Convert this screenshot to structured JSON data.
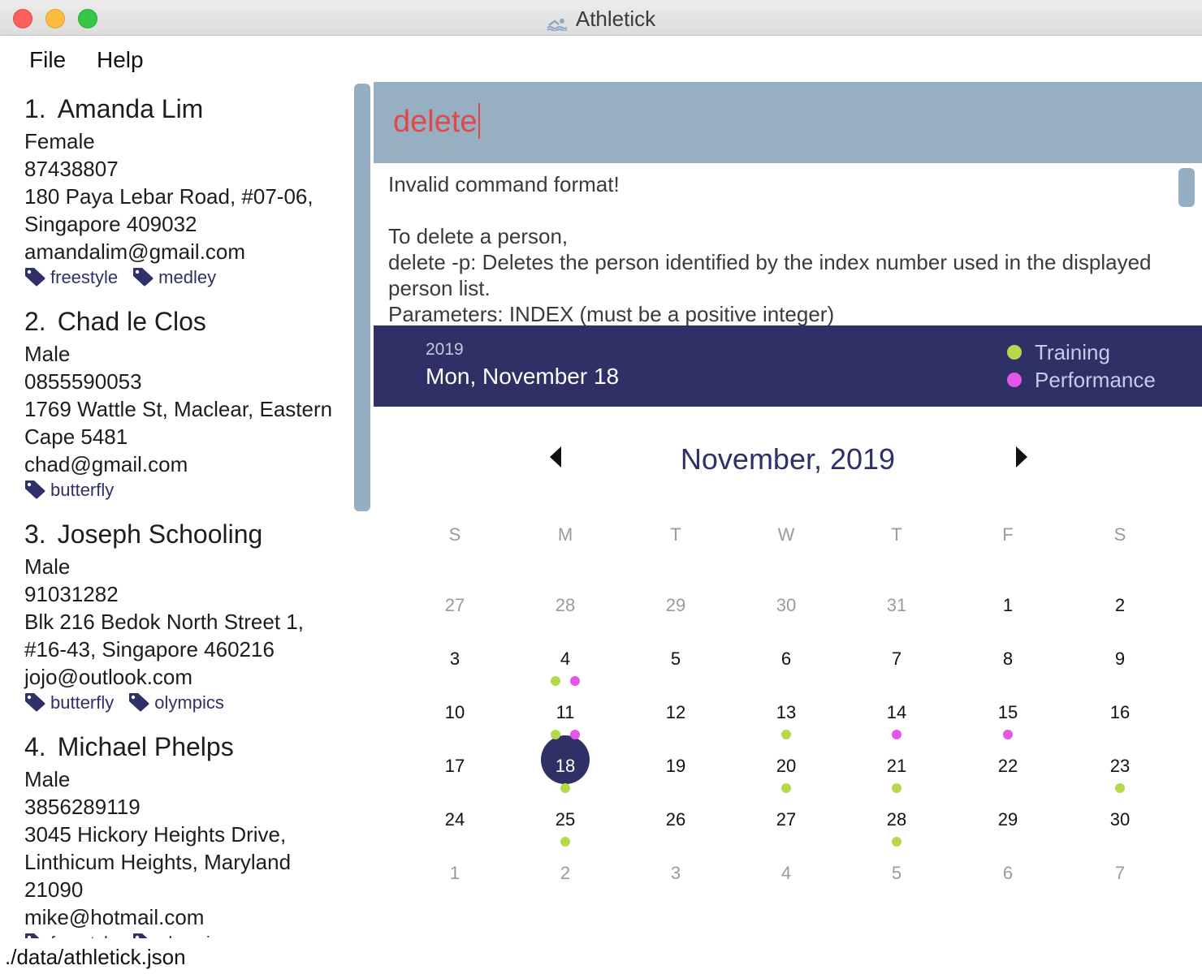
{
  "window": {
    "title": "Athletick"
  },
  "menu": {
    "file": "File",
    "help": "Help"
  },
  "persons": [
    {
      "index": "1.",
      "name": "Amanda Lim",
      "gender": "Female",
      "phone": "87438807",
      "address_lines": [
        "180 Paya Lebar Road, #07-06,",
        "Singapore 409032"
      ],
      "email": "amandalim@gmail.com",
      "tags": [
        "freestyle",
        "medley"
      ]
    },
    {
      "index": "2.",
      "name": "Chad le Clos",
      "gender": "Male",
      "phone": "0855590053",
      "address_lines": [
        "1769 Wattle St, Maclear, Eastern",
        "Cape 5481"
      ],
      "email": "chad@gmail.com",
      "tags": [
        "butterfly"
      ]
    },
    {
      "index": "3.",
      "name": "Joseph Schooling",
      "gender": "Male",
      "phone": "91031282",
      "address_lines": [
        "Blk 216 Bedok North Street 1,",
        "#16-43, Singapore 460216"
      ],
      "email": "jojo@outlook.com",
      "tags": [
        "butterfly",
        "olympics"
      ]
    },
    {
      "index": "4.",
      "name": "Michael Phelps",
      "gender": "Male",
      "phone": "3856289119",
      "address_lines": [
        "3045 Hickory Heights Drive,",
        "Linthicum Heights, Maryland",
        "21090"
      ],
      "email": "mike@hotmail.com",
      "tags": [
        "freestyle",
        "olympics"
      ]
    }
  ],
  "command": {
    "value": "delete"
  },
  "result": {
    "text": "Invalid command format!\n\nTo delete a person,\ndelete -p: Deletes the person identified by the index number used in the displayed person list.\nParameters: INDEX (must be a positive integer)"
  },
  "calendar_header": {
    "year": "2019",
    "date": "Mon, November 18",
    "legend": [
      {
        "label": "Training",
        "color": "#b5d94a"
      },
      {
        "label": "Performance",
        "color": "#e555e8"
      }
    ]
  },
  "calendar": {
    "month_title": "November, 2019",
    "weekdays": [
      "S",
      "M",
      "T",
      "W",
      "T",
      "F",
      "S"
    ],
    "selected": "18",
    "accent": "#2e3066",
    "weeks": [
      [
        {
          "d": "27",
          "o": true
        },
        {
          "d": "28",
          "o": true
        },
        {
          "d": "29",
          "o": true
        },
        {
          "d": "30",
          "o": true
        },
        {
          "d": "31",
          "o": true
        },
        {
          "d": "1"
        },
        {
          "d": "2"
        }
      ],
      [
        {
          "d": "3"
        },
        {
          "d": "4",
          "t": true,
          "p": true
        },
        {
          "d": "5"
        },
        {
          "d": "6"
        },
        {
          "d": "7"
        },
        {
          "d": "8"
        },
        {
          "d": "9"
        }
      ],
      [
        {
          "d": "10"
        },
        {
          "d": "11",
          "t": true,
          "p": true
        },
        {
          "d": "12"
        },
        {
          "d": "13",
          "t": true
        },
        {
          "d": "14",
          "p": true
        },
        {
          "d": "15",
          "p": true
        },
        {
          "d": "16"
        }
      ],
      [
        {
          "d": "17"
        },
        {
          "d": "18",
          "t": true,
          "sel": true
        },
        {
          "d": "19"
        },
        {
          "d": "20",
          "t": true
        },
        {
          "d": "21",
          "t": true
        },
        {
          "d": "22"
        },
        {
          "d": "23",
          "t": true
        }
      ],
      [
        {
          "d": "24"
        },
        {
          "d": "25",
          "t": true
        },
        {
          "d": "26"
        },
        {
          "d": "27"
        },
        {
          "d": "28",
          "t": true
        },
        {
          "d": "29"
        },
        {
          "d": "30"
        }
      ],
      [
        {
          "d": "1",
          "o": true
        },
        {
          "d": "2",
          "o": true
        },
        {
          "d": "3",
          "o": true
        },
        {
          "d": "4",
          "o": true
        },
        {
          "d": "5",
          "o": true
        },
        {
          "d": "6",
          "o": true
        },
        {
          "d": "7",
          "o": true
        }
      ]
    ]
  },
  "status": {
    "path": "./data/athletick.json"
  }
}
